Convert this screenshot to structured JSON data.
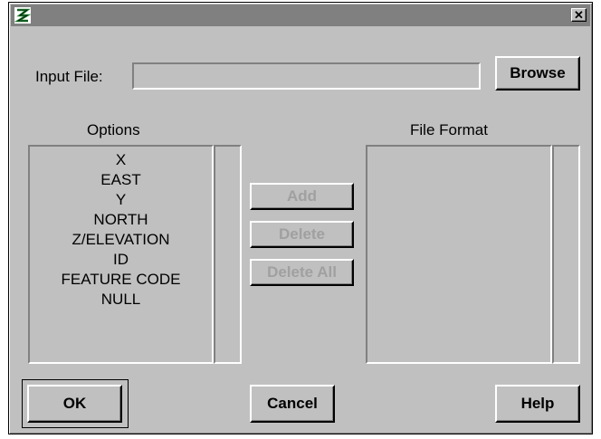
{
  "window": {
    "title": "",
    "close_glyph": "✕"
  },
  "input_file": {
    "label": "Input File:",
    "value": "",
    "browse_label": "Browse"
  },
  "options": {
    "header": "Options",
    "items": [
      "X",
      "EAST",
      "Y",
      "NORTH",
      "Z/ELEVATION",
      "ID",
      "FEATURE CODE",
      "NULL"
    ]
  },
  "file_format": {
    "header": "File Format",
    "items": []
  },
  "actions": {
    "add": "Add",
    "delete": "Delete",
    "delete_all": "Delete All"
  },
  "footer": {
    "ok": "OK",
    "cancel": "Cancel",
    "help": "Help"
  },
  "colors": {
    "face": "#c0c0c0",
    "title_bar": "#808080",
    "disabled_text": "#a0a0a0",
    "app_icon": "#1a7a2a"
  },
  "icons": {
    "app": "app-logo-icon",
    "close": "close-icon"
  }
}
